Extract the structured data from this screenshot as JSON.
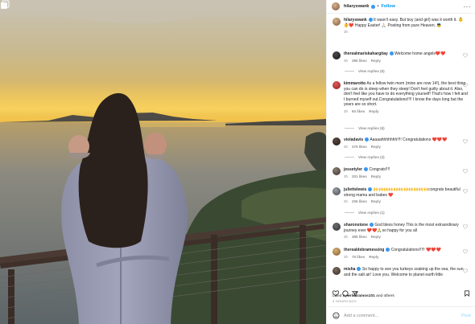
{
  "post": {
    "author": "hilaryswank",
    "follow_label": "Follow",
    "more_label": "···",
    "caption_user": "hilaryswank",
    "caption_text": "It wasn't easy. But boy (and girl) was it worth it. 👶👶❤️ Happy Easter! 🙏🏻 Posting from pure Heaven. 👼",
    "caption_time": "3h",
    "liked_by_prefix": "Liked by ",
    "liked_by_user": "erikaramos101",
    "liked_by_suffix": " and others",
    "time_ago": "3 HOURS AGO",
    "add_comment_placeholder": "Add a comment...",
    "post_label": "Post"
  },
  "comments": [
    {
      "user": "therealmariskahargitay",
      "text": "Welcome home angels❤️❤️",
      "time": "3h",
      "likes": "395 likes",
      "reply": "Reply",
      "view_replies": "View replies (6)"
    },
    {
      "user": "kimmarotto",
      "text": "As a fellow twin mom (mine are now 14!), the best thing you can do is sleep when they sleep! Don't feel guilty about it. Also, don't feel like you have to do everything yourself! That's how I felt and I burned myself out.Congratulations!!!! I know the days long but the years are so short.",
      "time": "3h",
      "likes": "60 likes",
      "reply": "Reply",
      "view_replies": "View replies (6)"
    },
    {
      "user": "violadavis",
      "text": "Aaaaahhhhhhh!!!! Congratulations ❤️❤️❤️",
      "time": "2h",
      "likes": "379 likes",
      "reply": "Reply",
      "view_replies": "View replies (3)"
    },
    {
      "user": "jessetyler",
      "text": "Congrats!!!!",
      "time": "2h",
      "likes": "201 likes",
      "reply": "Reply",
      "view_replies": ""
    },
    {
      "user": "juliettelewis",
      "text": "🙌🙌🙌🙌🙌🙌🙌🙌🙌🙌🙌congrats beautiful strong mama and babes ❤️",
      "time": "2h",
      "likes": "206 likes",
      "reply": "Reply",
      "view_replies": "View replies (1)"
    },
    {
      "user": "sharonstone",
      "text": "God bless honey This is the most extraordinary journey ever ❤️❤️🙏so happy for you all",
      "time": "3h",
      "likes": "385 likes",
      "reply": "Reply",
      "view_replies": ""
    },
    {
      "user": "therealdebramessing",
      "text": "Congratulations!!!!! ❤️❤️❤️",
      "time": "2h",
      "likes": "75 likes",
      "reply": "Reply",
      "view_replies": ""
    },
    {
      "user": "misha",
      "text": "So happy to see you turkeys soaking up the sea, the sun and the salt air! Love you. Welcome to planet earth little",
      "time": "",
      "likes": "",
      "reply": "",
      "view_replies": ""
    }
  ],
  "colors": {
    "accent": "#0095f6",
    "verified": "#3897f0",
    "muted": "#8e8e8e",
    "heart": "#ed4956"
  },
  "icons": [
    "carousel-icon",
    "more-icon",
    "heart-icon",
    "comment-icon",
    "share-icon",
    "bookmark-icon",
    "emoji-icon",
    "verified-icon"
  ]
}
